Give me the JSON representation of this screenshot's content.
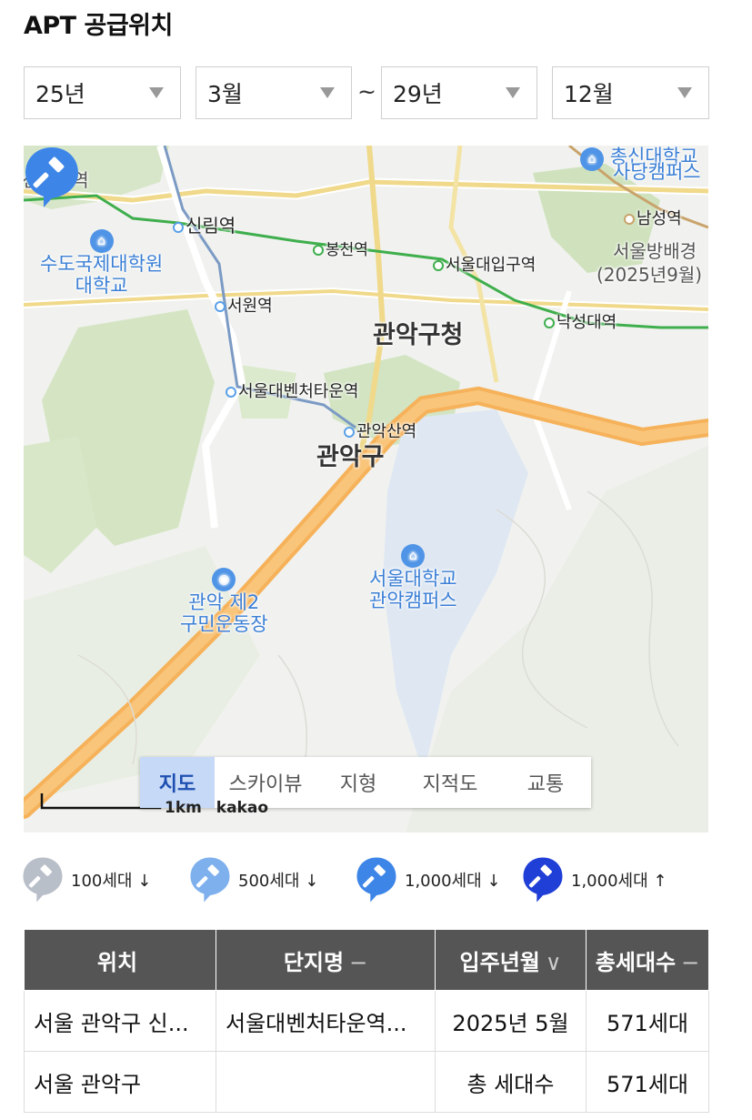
{
  "title": "APT 공급위치",
  "filters": {
    "start_year": "25년",
    "start_month": "3월",
    "separator": "~",
    "end_year": "29년",
    "end_month": "12월"
  },
  "map": {
    "labels": {
      "sindaebang": "신대방역",
      "sillim": "신림역",
      "bongcheon": "봉천역",
      "seouldae_ipgu": "서울대입구역",
      "chongsin": "총신대학교",
      "sadang_campus": "사당캠퍼스",
      "namseong": "남성역",
      "seoul_bangbae": "서울방배경",
      "bangbae_date": "(2025년9월)",
      "sudo_grad": "수도국제대학원",
      "sudo_univ": "대학교",
      "seowon": "서원역",
      "gwanak_office": "관악구청",
      "nakseongdae": "낙성대역",
      "venture_town": "서울대벤처타운역",
      "gwanaksan": "관악산역",
      "gwanak_gu": "관악구",
      "snu": "서울대학교",
      "snu_campus": "관악캠퍼스",
      "stadium1": "관악 제2",
      "stadium2": "구민운동장"
    },
    "scale": "1km",
    "brand": "kakao",
    "tabs": [
      "지도",
      "스카이뷰",
      "지형",
      "지적도",
      "교통"
    ],
    "active_tab": "지도"
  },
  "legend": [
    {
      "label": "100세대 ↓",
      "color": "#b9bfc9",
      "icon": "hammer-pin-icon"
    },
    {
      "label": "500세대 ↓",
      "color": "#7fb0ee",
      "icon": "hammer-pin-icon"
    },
    {
      "label": "1,000세대 ↓",
      "color": "#3d86e8",
      "icon": "hammer-pin-icon"
    },
    {
      "label": "1,000세대 ↑",
      "color": "#1f3fd6",
      "icon": "hammer-pin-icon"
    }
  ],
  "table": {
    "headers": [
      {
        "label": "위치",
        "sort": ""
      },
      {
        "label": "단지명",
        "sort": "−"
      },
      {
        "label": "입주년월",
        "sort": "∨"
      },
      {
        "label": "총세대수",
        "sort": "−"
      }
    ],
    "rows": [
      {
        "location": "서울 관악구 신...",
        "name": "서울대벤처타운역...",
        "date": "2025년 5월",
        "units": "571세대"
      }
    ],
    "total": {
      "location": "서울 관악구",
      "name": "",
      "label": "총 세대수",
      "units": "571세대"
    }
  }
}
